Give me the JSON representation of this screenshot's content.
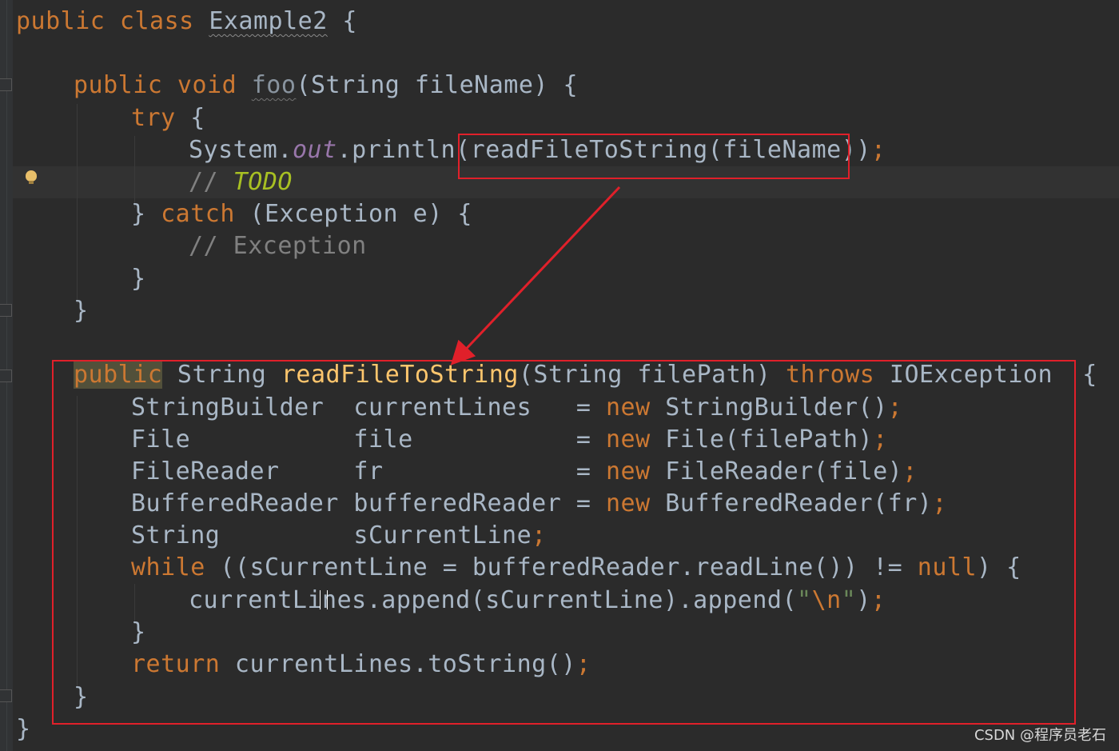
{
  "code": {
    "l1": [
      "public class ",
      "Example2",
      " {"
    ],
    "l2": [
      "public void ",
      "foo",
      "(String fileName) {"
    ],
    "l3": [
      "try",
      " {"
    ],
    "l4": [
      "System.",
      "out",
      ".println(readFileToString(fileName))",
      ";"
    ],
    "l5": [
      "// ",
      "TODO"
    ],
    "l6": [
      "} ",
      "catch",
      " (Exception e) {"
    ],
    "l7": [
      "// Exception"
    ],
    "l8": [
      "}"
    ],
    "l9": [
      "}"
    ],
    "l10": [
      "public",
      " String ",
      "readFileToString",
      "(String filePath) ",
      "throws",
      " IOException  {"
    ],
    "l11": [
      "StringBuilder  currentLines   = ",
      "new",
      " StringBuilder()",
      ";"
    ],
    "l12": [
      "File           file           = ",
      "new",
      " File(filePath)",
      ";"
    ],
    "l13": [
      "FileReader     fr             = ",
      "new",
      " FileReader(file)",
      ";"
    ],
    "l14": [
      "BufferedReader bufferedReader = ",
      "new",
      " BufferedReader(fr)",
      ";"
    ],
    "l15": [
      "String         sCurrentLine",
      ";"
    ],
    "l16": [
      "while",
      " ((sCurrentLine = bufferedReader.readLine()) != ",
      "null",
      ") {"
    ],
    "l17": [
      "currentLines.append(sCurrentLine).append(",
      "\"",
      "\\n",
      "\"",
      ")",
      ";"
    ],
    "l18": [
      "}"
    ],
    "l19": [
      "return",
      " currentLines.toString()",
      ";"
    ],
    "l20": [
      "}"
    ],
    "l21": [
      "}"
    ]
  },
  "watermark": "CSDN @程序员老石",
  "colors": {
    "background": "#2b2b2b",
    "keyword": "#cc7832",
    "method": "#ffc66d",
    "annotation_box": "#e0202a"
  },
  "icons": {
    "bulb": "lightbulb-icon"
  }
}
